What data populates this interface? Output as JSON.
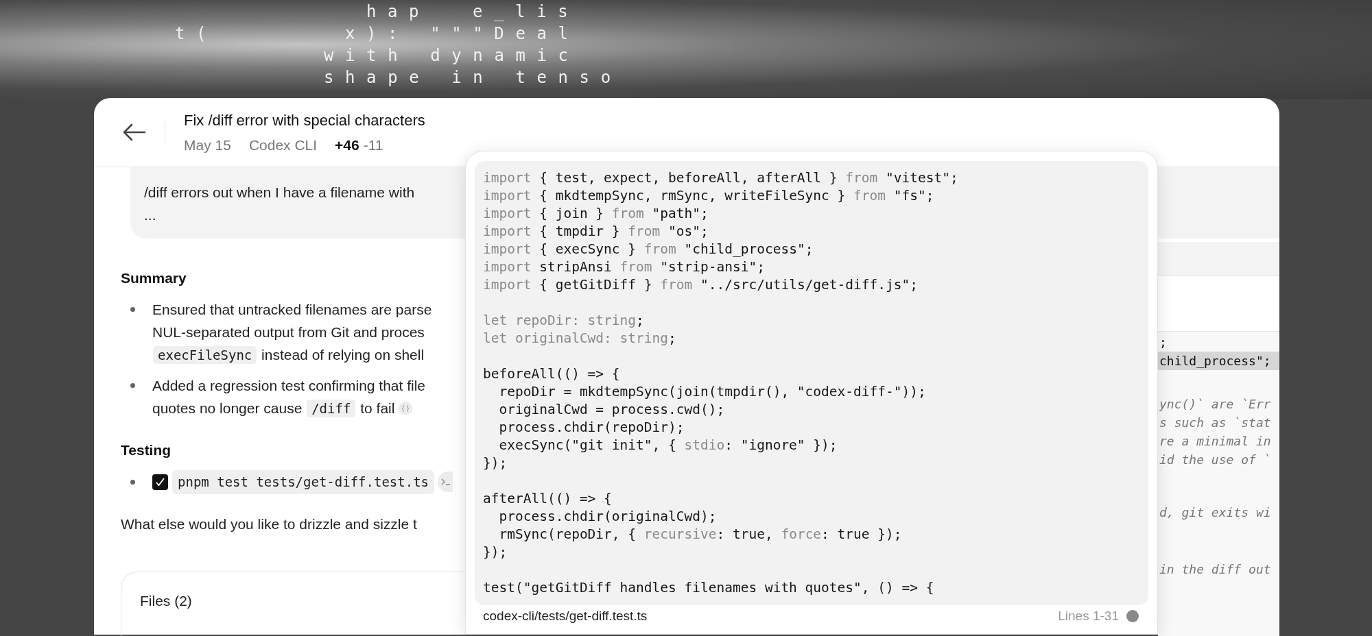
{
  "background_art": {
    "rows": [
      [
        "hap",
        "e_lis"
      ],
      [
        "t(",
        "x): \"\"\"Deal"
      ],
      [
        "with dynamic"
      ],
      [
        "shape in tenso"
      ]
    ]
  },
  "header": {
    "title": "Fix /diff error with special characters",
    "date": "May 15",
    "source": "Codex CLI",
    "additions": "+46",
    "deletions": "-11"
  },
  "message": {
    "lines": [
      "/diff errors out when I have a filename with",
      "..."
    ]
  },
  "summary": {
    "heading": "Summary",
    "bullets": [
      {
        "lines": [
          [
            {
              "kind": "text",
              "text": "Ensured that untracked filenames are parse"
            }
          ],
          [
            {
              "kind": "text",
              "text": "NUL-separated output from Git and proces"
            }
          ],
          [
            {
              "kind": "code",
              "text": "execFileSync"
            },
            {
              "kind": "text",
              "text": " instead of relying on shell"
            }
          ]
        ]
      },
      {
        "lines": [
          [
            {
              "kind": "text",
              "text": "Added a regression test confirming that file"
            }
          ],
          [
            {
              "kind": "text",
              "text": "quotes no longer cause "
            },
            {
              "kind": "code",
              "text": "/diff"
            },
            {
              "kind": "text",
              "text": " to fail"
            }
          ]
        ]
      }
    ]
  },
  "testing": {
    "heading": "Testing",
    "items": [
      {
        "checked": true,
        "command": "pnpm test tests/get-diff.test.ts"
      }
    ]
  },
  "follow_up": "What else would you like to drizzle and sizzle t",
  "files": {
    "title": "Files (2)"
  },
  "background_code": [
    {
      "kind": "code",
      "text": ";",
      "highlighted": false
    },
    {
      "kind": "code",
      "text": "child_process\";",
      "highlighted": true
    },
    {
      "kind": "comment",
      "text": "ync()` are `Err",
      "highlighted": false
    },
    {
      "kind": "comment",
      "text": "s such as `stat",
      "highlighted": false
    },
    {
      "kind": "comment",
      "text": "re a minimal in",
      "highlighted": false
    },
    {
      "kind": "comment",
      "text": "id the use of `",
      "highlighted": false
    },
    {
      "kind": "comment",
      "text": "d, git exits wi",
      "highlighted": false
    },
    {
      "kind": "comment",
      "text": "in the diff out",
      "highlighted": false
    }
  ],
  "code_popup": {
    "blocks": [
      [
        [
          {
            "kind": "keyword",
            "text": "import"
          },
          {
            "kind": "plain",
            "text": " { test, expect, beforeAll, afterAll } "
          },
          {
            "kind": "keyword",
            "text": "from"
          },
          {
            "kind": "plain",
            "text": " \"vitest\";"
          }
        ],
        [
          {
            "kind": "keyword",
            "text": "import"
          },
          {
            "kind": "plain",
            "text": " { mkdtempSync, rmSync, writeFileSync } "
          },
          {
            "kind": "keyword",
            "text": "from"
          },
          {
            "kind": "plain",
            "text": " \"fs\";"
          }
        ],
        [
          {
            "kind": "keyword",
            "text": "import"
          },
          {
            "kind": "plain",
            "text": " { join } "
          },
          {
            "kind": "keyword",
            "text": "from"
          },
          {
            "kind": "plain",
            "text": " \"path\";"
          }
        ],
        [
          {
            "kind": "keyword",
            "text": "import"
          },
          {
            "kind": "plain",
            "text": " { tmpdir } "
          },
          {
            "kind": "keyword",
            "text": "from"
          },
          {
            "kind": "plain",
            "text": " \"os\";"
          }
        ],
        [
          {
            "kind": "keyword",
            "text": "import"
          },
          {
            "kind": "plain",
            "text": " { execSync } "
          },
          {
            "kind": "keyword",
            "text": "from"
          },
          {
            "kind": "plain",
            "text": " \"child_process\";"
          }
        ],
        [
          {
            "kind": "keyword",
            "text": "import"
          },
          {
            "kind": "plain",
            "text": " stripAnsi "
          },
          {
            "kind": "keyword",
            "text": "from"
          },
          {
            "kind": "plain",
            "text": " \"strip-ansi\";"
          }
        ],
        [
          {
            "kind": "keyword",
            "text": "import"
          },
          {
            "kind": "plain",
            "text": " { getGitDiff } "
          },
          {
            "kind": "keyword",
            "text": "from"
          },
          {
            "kind": "plain",
            "text": " \"../src/utils/get-diff.js\";"
          }
        ]
      ],
      [
        [
          {
            "kind": "keyword",
            "text": "let repoDir: string"
          },
          {
            "kind": "plain",
            "text": ";"
          }
        ],
        [
          {
            "kind": "keyword",
            "text": "let originalCwd: string"
          },
          {
            "kind": "plain",
            "text": ";"
          }
        ]
      ],
      [
        [
          {
            "kind": "plain",
            "text": "beforeAll(() => {"
          }
        ],
        [
          {
            "kind": "plain",
            "text": "  repoDir = mkdtempSync(join(tmpdir(), \"codex-diff-\"));"
          }
        ],
        [
          {
            "kind": "plain",
            "text": "  originalCwd = process.cwd();"
          }
        ],
        [
          {
            "kind": "plain",
            "text": "  process.chdir(repoDir);"
          }
        ],
        [
          {
            "kind": "plain",
            "text": "  execSync(\"git init\", { "
          },
          {
            "kind": "keyword",
            "text": "stdio"
          },
          {
            "kind": "plain",
            "text": ": \"ignore\" });"
          }
        ],
        [
          {
            "kind": "plain",
            "text": "});"
          }
        ]
      ],
      [
        [
          {
            "kind": "plain",
            "text": "afterAll(() => {"
          }
        ],
        [
          {
            "kind": "plain",
            "text": "  process.chdir(originalCwd);"
          }
        ],
        [
          {
            "kind": "plain",
            "text": "  rmSync(repoDir, { "
          },
          {
            "kind": "keyword",
            "text": "recursive"
          },
          {
            "kind": "plain",
            "text": ": true, "
          },
          {
            "kind": "keyword",
            "text": "force"
          },
          {
            "kind": "plain",
            "text": ": true });"
          }
        ],
        [
          {
            "kind": "plain",
            "text": "});"
          }
        ]
      ],
      [
        [
          {
            "kind": "plain",
            "text": "test(\"getGitDiff handles filenames with quotes\", () => {"
          }
        ]
      ]
    ],
    "file_path": "codex-cli/tests/get-diff.test.ts",
    "line_range": "Lines 1-31"
  }
}
